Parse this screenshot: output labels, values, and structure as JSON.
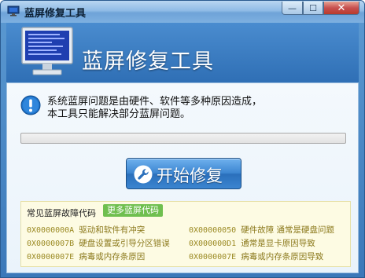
{
  "window": {
    "title": "蓝屏修复工具",
    "minimize_glyph": "—",
    "maximize_glyph": "☐",
    "close_glyph": "✕"
  },
  "header": {
    "app_title": "蓝屏修复工具",
    "icon": "bsod-monitor-icon"
  },
  "main": {
    "description_line1": "系统蓝屏问题是由硬件、软件等多种原因造成，",
    "description_line2": "本工具只能解决部分蓝屏问题。",
    "info_icon": "info-icon",
    "progress": 0,
    "start_button_label": "开始修复",
    "start_button_icon": "wrench-icon"
  },
  "codes": {
    "title": "常见蓝屏故障代码",
    "more_link": "更多蓝屏代码",
    "items": [
      {
        "code": "0X0000000A",
        "desc": "驱动和软件有冲突"
      },
      {
        "code": "0X00000050",
        "desc": "硬件故障 通常是硬盘问题"
      },
      {
        "code": "0X0000007B",
        "desc": "硬盘设置或引导分区错误"
      },
      {
        "code": "0X000000D1",
        "desc": "通常是显卡原因导致"
      },
      {
        "code": "0X0000007E",
        "desc": "病毒或内存条原因"
      },
      {
        "code": "0X0000007E",
        "desc": "病毒或内存条原因导致"
      }
    ]
  },
  "colors": {
    "accent": "#3b78b9",
    "button": "#3d86d1",
    "code_text": "#8a7a1c",
    "more_bg": "#6fbf4f"
  }
}
